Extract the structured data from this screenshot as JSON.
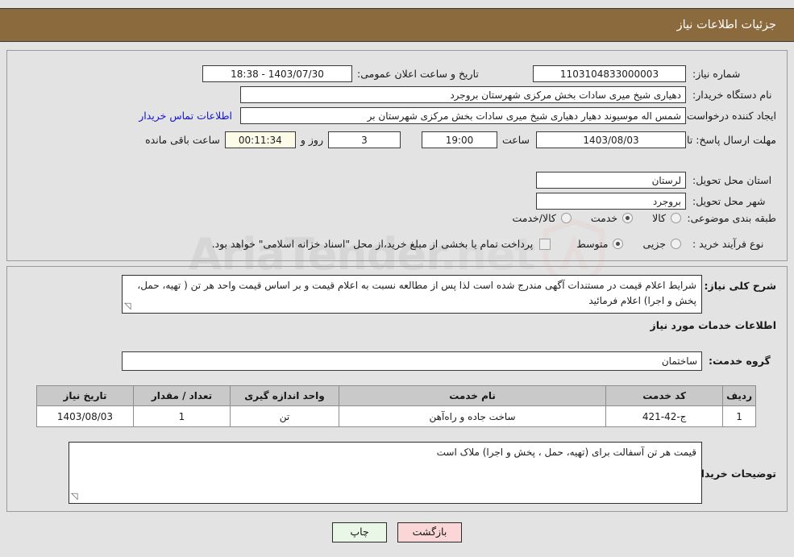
{
  "header": {
    "title": "جزئیات اطلاعات نیاز"
  },
  "watermark": {
    "text": "AriaTender",
    "suffix": ".net"
  },
  "form": {
    "need_number_label": "شماره نیاز:",
    "need_number_value": "1103104833000003",
    "announce_datetime_label": "تاریخ و ساعت اعلان عمومی:",
    "announce_datetime_value": "1403/07/30 - 18:38",
    "buyer_org_label": "نام دستگاه خریدار:",
    "buyer_org_value": "دهیاری شیخ میری سادات بخش مرکزی شهرستان بروجرد",
    "requester_label": "ایجاد کننده درخواست:",
    "requester_value": "شمس اله موسیوند دهیار دهیاری شیخ میری سادات بخش مرکزی شهرستان بر",
    "buyer_contact_link": "اطلاعات تماس خریدار",
    "deadline_label": "مهلت ارسال پاسخ: تا تاریخ:",
    "deadline_date": "1403/08/03",
    "hour_label": "ساعت",
    "hour_value": "19:00",
    "days_value": "3",
    "days_label": "روز و",
    "countdown_value": "00:11:34",
    "remaining_label": "ساعت باقی مانده",
    "province_label": "استان محل تحویل:",
    "province_value": "لرستان",
    "city_label": "شهر محل تحویل:",
    "city_value": "بروجرد",
    "category_label": "طبقه بندی موضوعی:",
    "category_options": [
      {
        "label": "کالا",
        "selected": false
      },
      {
        "label": "خدمت",
        "selected": true
      },
      {
        "label": "کالا/خدمت",
        "selected": false
      }
    ],
    "process_label": "نوع فرآیند خرید :",
    "process_options": [
      {
        "label": "جزیی",
        "selected": false
      },
      {
        "label": "متوسط",
        "selected": true
      }
    ],
    "treasury_checkbox_checked": false,
    "treasury_text": "پرداخت تمام یا بخشی از مبلغ خرید،از محل \"اسناد خزانه اسلامی\" خواهد بود."
  },
  "description": {
    "label": "شرح کلی نیاز:",
    "text": "شرایط اعلام قیمت در مستندات آگهی مندرج شده است لذا پس از مطالعه نسبت به اعلام قیمت و بر اساس قیمت واحد هر تن ( تهیه، حمل، پخش و اجرا) اعلام فرمائید"
  },
  "services": {
    "section_title": "اطلاعات خدمات مورد نیاز",
    "group_label": "گروه خدمت:",
    "group_value": "ساختمان",
    "columns": [
      "ردیف",
      "کد خدمت",
      "نام خدمت",
      "واحد اندازه گیری",
      "تعداد / مقدار",
      "تاریخ نیاز"
    ],
    "rows": [
      {
        "row": "1",
        "code": "ج-42-421",
        "name": "ساخت جاده و راه‌آهن",
        "unit": "تن",
        "qty": "1",
        "date": "1403/08/03"
      }
    ]
  },
  "buyer_notes": {
    "label": "توضیحات خریدار:",
    "text": "قیمت هر تن آسفالت برای (تهیه، حمل ، پخش و اجرا) ملاک است"
  },
  "buttons": {
    "print": "چاپ",
    "back": "بازگشت"
  },
  "colors": {
    "header_bg": "#8b6b3d",
    "page_bg": "#e3e3e3",
    "link": "#1414d0",
    "print_btn": "#e9f7e7",
    "back_btn": "#fbd6d6",
    "table_header": "#c9c9c9",
    "countdown_bg": "#fbfbe8"
  }
}
